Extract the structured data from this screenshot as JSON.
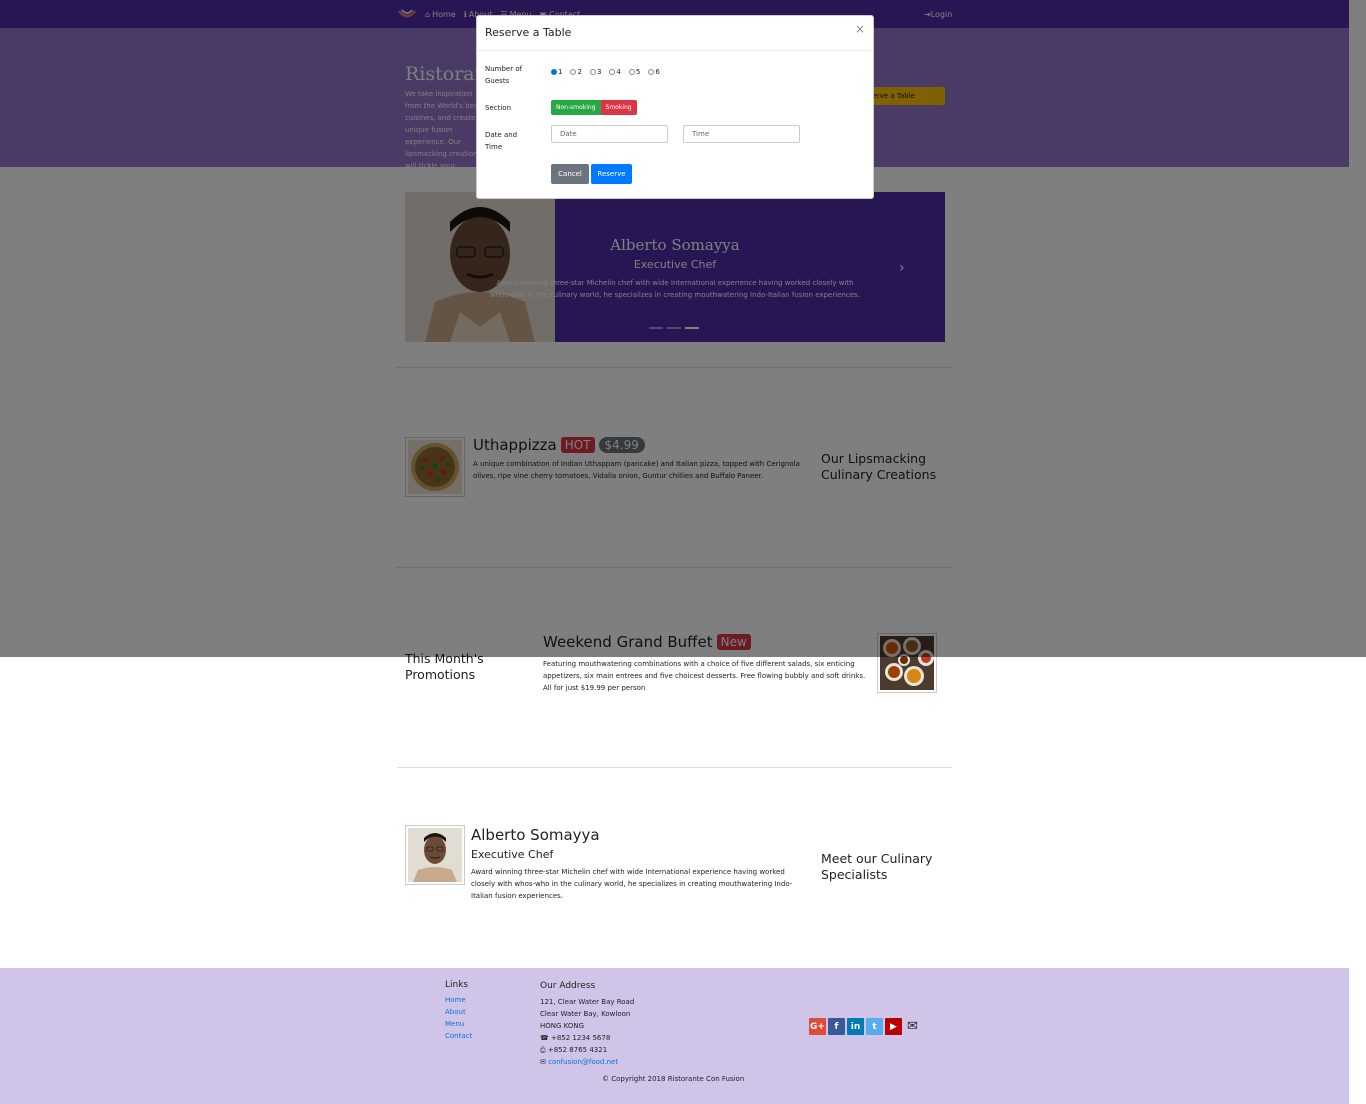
{
  "navbar": {
    "home": "Home",
    "about": "About",
    "menu": "Menu",
    "contact": "Contact",
    "login": "Login"
  },
  "jumbotron": {
    "title": "Ristorante Con Fusion",
    "text": "We take inspiration from the World's best cuisines, and create a unique fusion experience. Our lipsmacking creations will tickle your culinary senses!",
    "reserve_button": "Reserve a Table"
  },
  "carousel": {
    "name": "Alberto Somayya",
    "role": "Executive Chef",
    "description": "Award winning three-star Michelin chef with wide International experience having worked closely with whos-who in the culinary world, he specializes in creating mouthwatering Indo-Italian fusion experiences."
  },
  "dish": {
    "name": "Uthappizza",
    "badge": "HOT",
    "price": "$4.99",
    "description": "A unique combination of Indian Uthappam (pancake) and Italian pizza, topped with Cerignola olives, ripe vine cherry tomatoes, Vidalia onion, Guntur chillies and Buffalo Paneer.",
    "side_title": "Our Lipsmacking Culinary Creations"
  },
  "promotion": {
    "name": "Weekend Grand Buffet",
    "badge": "New",
    "description": "Featuring mouthwatering combinations with a choice of five different salads, six enticing appetizers, six main entrees and five choicest desserts. Free flowing bubbly and soft drinks. All for just $19.99 per person",
    "side_title": "This Month's Promotions"
  },
  "leader": {
    "name": "Alberto Somayya",
    "role": "Executive Chef",
    "description": "Award winning three-star Michelin chef with wide International experience having worked closely with whos-who in the culinary world, he specializes in creating mouthwatering Indo-Italian fusion experiences.",
    "side_title": "Meet our Culinary Specialists"
  },
  "footer": {
    "links_title": "Links",
    "links": [
      "Home",
      "About",
      "Menu",
      "Contact"
    ],
    "address_title": "Our Address",
    "address_line1": "121, Clear Water Bay Road",
    "address_line2": "Clear Water Bay, Kowloon",
    "address_line3": "HONG KONG",
    "phone": "+852 1234 5678",
    "fax": "+852 8765 4321",
    "email": "confusion@food.net",
    "copyright": "© Copyright 2018 Ristorante Con Fusion"
  },
  "modal": {
    "title": "Reserve a Table",
    "close": "×",
    "guests_label": "Number of Guests",
    "guests_options": [
      "1",
      "2",
      "3",
      "4",
      "5",
      "6"
    ],
    "guests_selected": "1",
    "section_label": "Section",
    "section_options": [
      "Non-smoking",
      "Smoking"
    ],
    "datetime_label": "Date and Time",
    "date_placeholder": "Date",
    "time_placeholder": "Time",
    "cancel": "Cancel",
    "reserve": "Reserve"
  },
  "colors": {
    "primary": "#512DA8",
    "jumbotron": "#9575CD",
    "footer": "#D1C4E9",
    "warning": "#FFC107",
    "danger": "#dc3545",
    "success": "#28a745",
    "secondary": "#6c757d",
    "blue": "#007bff"
  }
}
